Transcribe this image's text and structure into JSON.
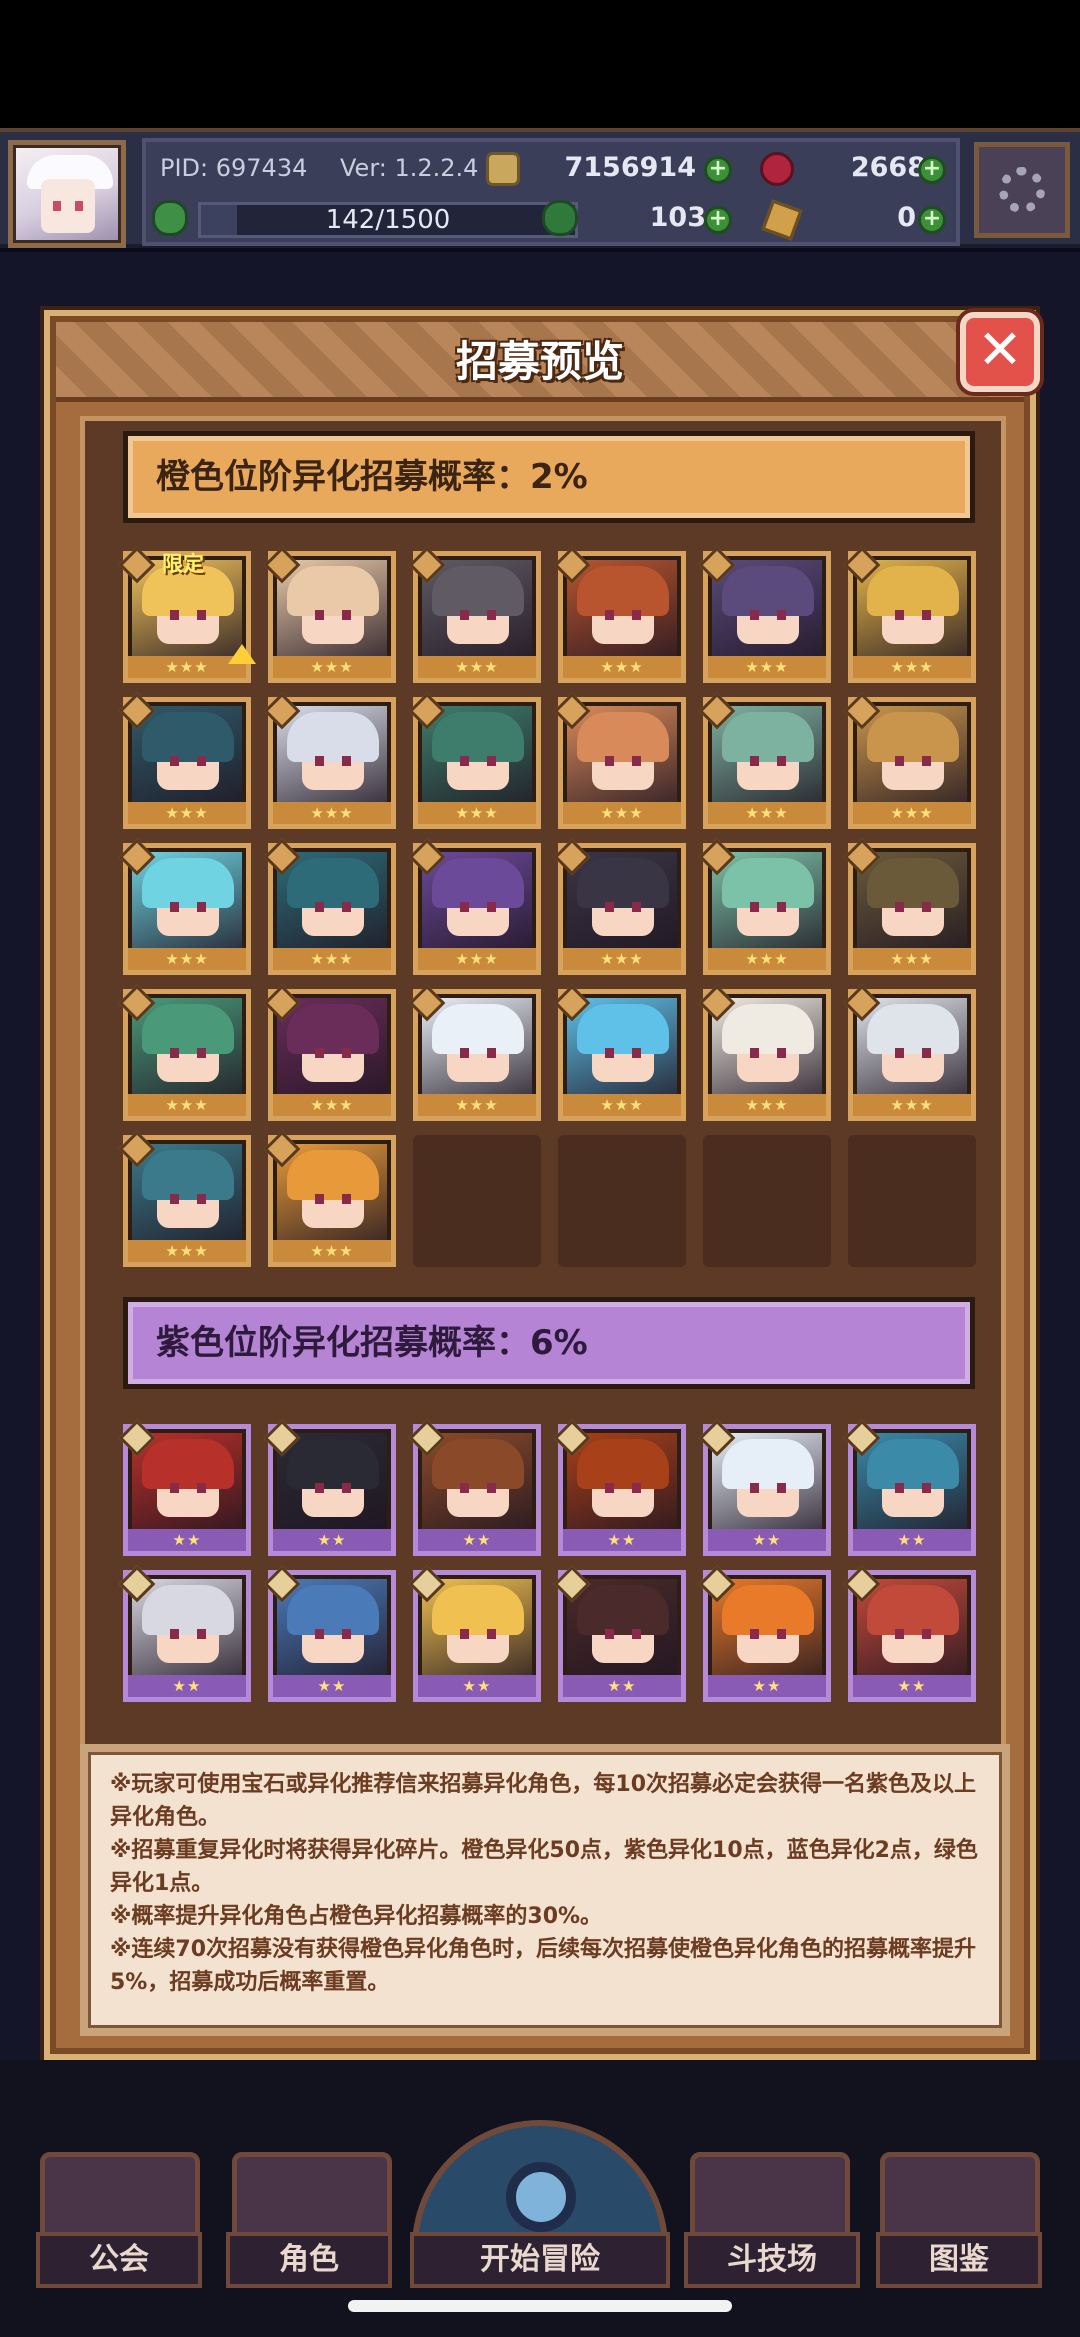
{
  "header": {
    "pid": "PID: 697434",
    "version": "Ver: 1.2.2.4",
    "gold": "7156914",
    "gems": "2668",
    "exp": "142/1500",
    "exp_progress": 0.095,
    "clover": "103",
    "shards": "0"
  },
  "modal": {
    "title": "招募预览",
    "close_label": "✕",
    "orange_tier": {
      "label": "橙色位阶异化招募概率：2%",
      "card_count": 26,
      "limited_tag": "限定",
      "stars": "★★★"
    },
    "purple_tier": {
      "label": "紫色位阶异化招募概率：6%",
      "card_count": 12,
      "stars": "★★"
    },
    "info_lines": [
      "※玩家可使用宝石或异化推荐信来招募异化角色，每10次招募必定会获得一名紫色及以上异化角色。",
      "※招募重复异化时将获得异化碎片。橙色异化50点，紫色异化10点，蓝色异化2点，绿色异化1点。",
      "※概率提升异化角色占橙色异化招募概率的30%。",
      "※连续70次招募没有获得橙色异化角色时，后续每次招募使橙色异化角色的招募概率提升5%，招募成功后概率重置。"
    ]
  },
  "nav": {
    "guild": "公会",
    "characters": "角色",
    "adventure": "开始冒险",
    "arena": "斗技场",
    "codex": "图鉴"
  },
  "colors": {
    "orange_tier": "#e8a95c",
    "purple_tier": "#b584d4",
    "modal_frame": "#a56c3e",
    "info_text": "#6b3c21"
  }
}
